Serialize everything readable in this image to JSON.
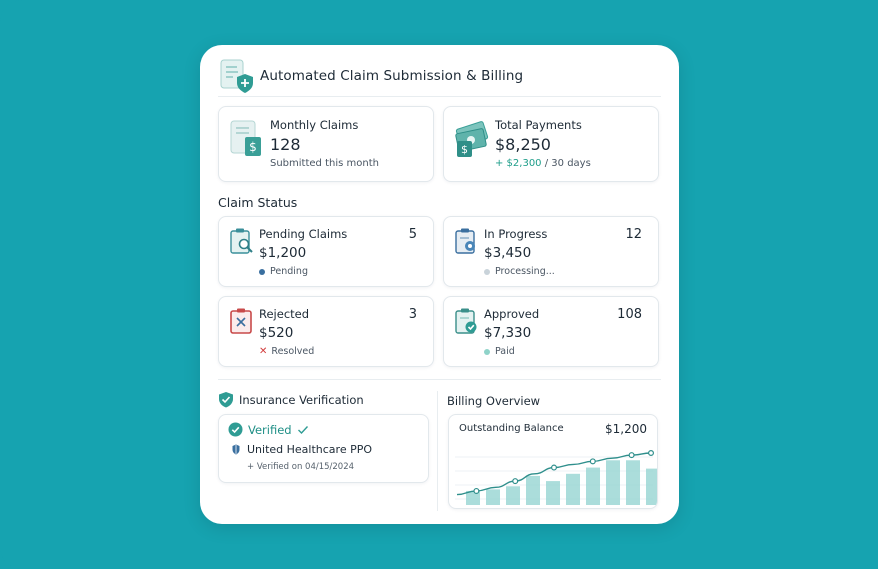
{
  "header": {
    "title": "Automated Claim Submission & Billing",
    "icon": "document-shield-icon"
  },
  "metrics": [
    {
      "label": "Monthly Claims",
      "value": "128",
      "sub": "Submitted this month",
      "icon": "document-dollar-icon"
    },
    {
      "label": "Total Payments",
      "value": "$8,250",
      "sub_positive": "+ $2,300",
      "sub_rest": " / 30 days",
      "icon": "money-bill-icon"
    }
  ],
  "claim_status": {
    "title": "Claim Status",
    "cards": [
      {
        "label": "Pending Claims",
        "count": "5",
        "amount": "$1,200",
        "status": "Pending",
        "icon": "clipboard-search-icon",
        "status_color": "#3a6f9f"
      },
      {
        "label": "In Progress",
        "count": "12",
        "amount": "$3,450",
        "status": "Processing...",
        "icon": "clipboard-gear-icon",
        "status_color": "#c9d3da"
      },
      {
        "label": "Rejected",
        "count": "3",
        "amount": "$520",
        "status": "Resolved",
        "icon": "clipboard-x-icon",
        "status_color": "#d23c3c"
      },
      {
        "label": "Approved",
        "count": "108",
        "amount": "$7,330",
        "status": "Paid",
        "icon": "clipboard-check-icon",
        "status_color": "#8fd3c9"
      }
    ]
  },
  "insurance": {
    "title": "Insurance Verification",
    "verified_label": "Verified",
    "plan": "United Healthcare PPO",
    "verified_date": "+ Verified on 04/15/2024"
  },
  "billing": {
    "title": "Billing Overview",
    "outstanding_label": "Outstanding Balance",
    "outstanding_value": "$1,200"
  },
  "chart_data": {
    "type": "bar",
    "bars": [
      0.27,
      0.3,
      0.36,
      0.56,
      0.46,
      0.6,
      0.72,
      0.86,
      0.86,
      0.7
    ],
    "line": [
      0.2,
      0.27,
      0.34,
      0.46,
      0.6,
      0.72,
      0.78,
      0.84,
      0.9,
      0.96,
      1.0
    ],
    "bar_color": "#8fd1cf",
    "line_color": "#2f8f8c"
  },
  "colors": {
    "background": "#16a3b0",
    "accent": "#1f8f86"
  }
}
